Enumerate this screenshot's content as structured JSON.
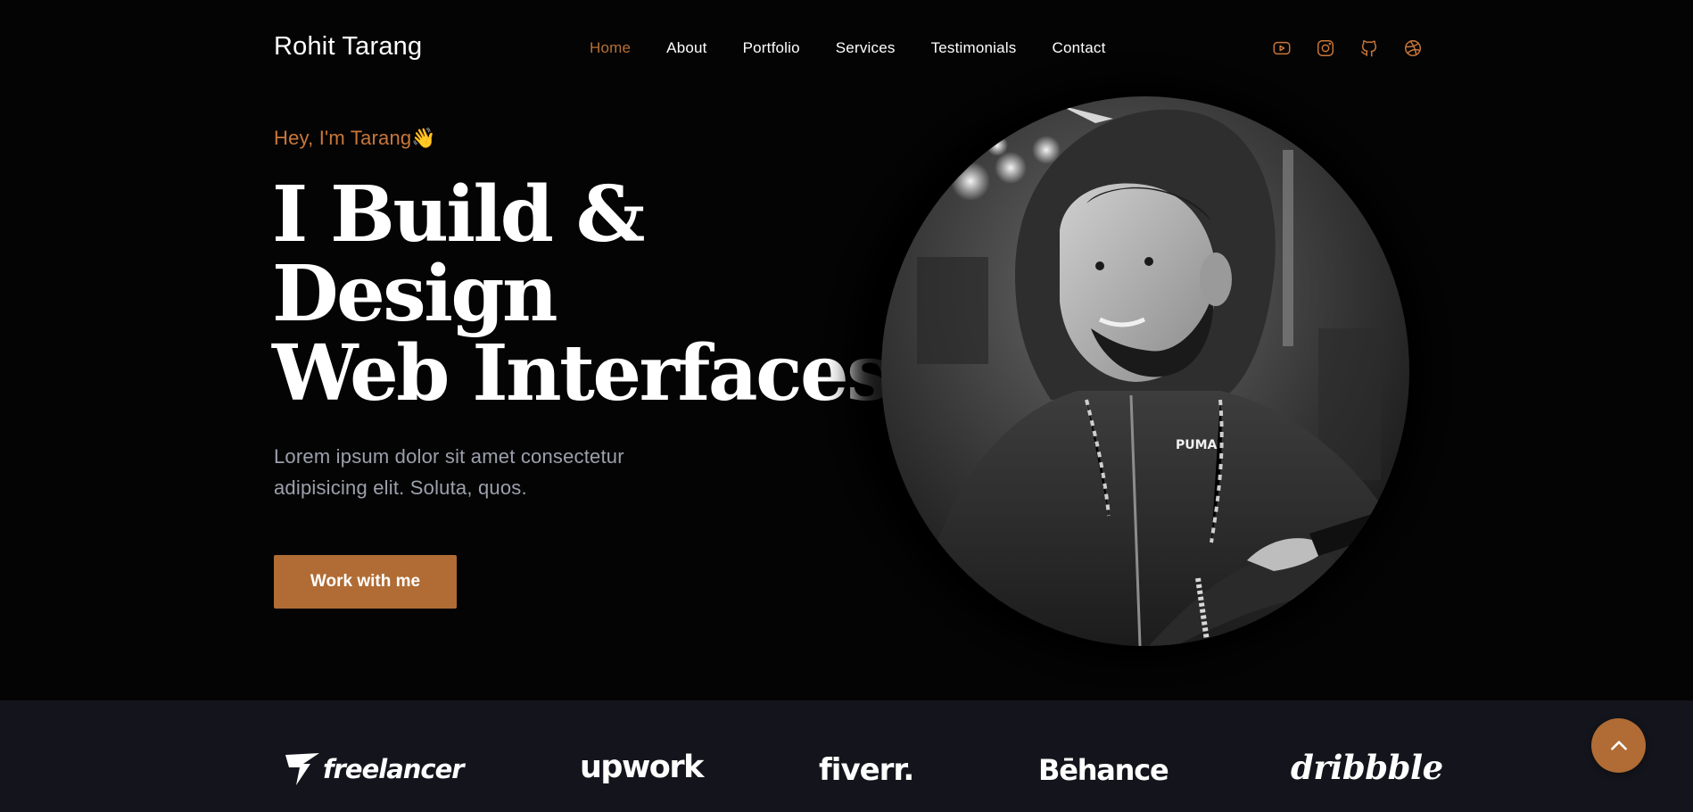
{
  "header": {
    "brand": "Rohit Tarang",
    "nav": [
      {
        "label": "Home",
        "active": true
      },
      {
        "label": "About",
        "active": false
      },
      {
        "label": "Portfolio",
        "active": false
      },
      {
        "label": "Services",
        "active": false
      },
      {
        "label": "Testimonials",
        "active": false
      },
      {
        "label": "Contact",
        "active": false
      }
    ],
    "socials": [
      {
        "icon": "youtube-icon"
      },
      {
        "icon": "instagram-icon"
      },
      {
        "icon": "github-icon"
      },
      {
        "icon": "dribbble-icon"
      }
    ]
  },
  "hero": {
    "greeting": "Hey, I'm Tarang",
    "greeting_emoji": "👋",
    "headline_lines": [
      "I Build &",
      "Design",
      "Web Interfaces."
    ],
    "subtext": "Lorem ipsum dolor sit amet consectetur adipisicing elit. Soluta, quos.",
    "cta_label": "Work with me"
  },
  "logos": [
    {
      "name": "freelancer",
      "text": "freelancer"
    },
    {
      "name": "upwork",
      "text": "upwork"
    },
    {
      "name": "fiverr",
      "text": "fiverr."
    },
    {
      "name": "behance",
      "text": "Bēhance"
    },
    {
      "name": "dribbble",
      "text": "dribbble"
    }
  ],
  "colors": {
    "accent": "#b06c34",
    "accent_text": "#c8773a",
    "background": "#050404",
    "strip": "#14151c",
    "muted_text": "#9ba0ad"
  }
}
